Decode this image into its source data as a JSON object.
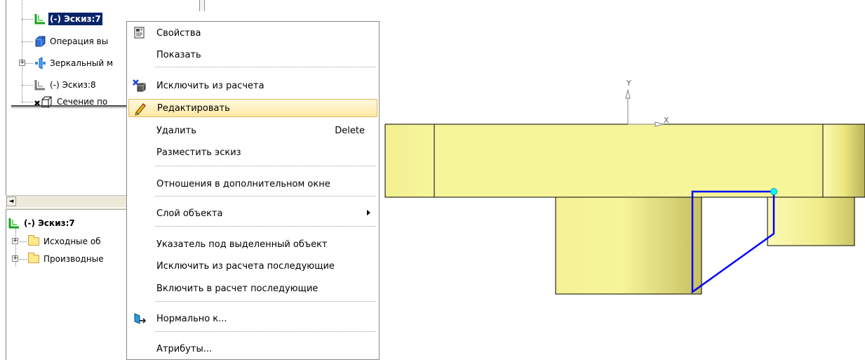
{
  "tree": {
    "nodes": [
      {
        "label": "(-) Эскиз:7",
        "icon": "sketch-icon",
        "selected": true
      },
      {
        "label": "Операция вы",
        "icon": "extrude-operation-icon"
      },
      {
        "label": "Зеркальный м",
        "icon": "mirror-array-icon",
        "expander": "+"
      },
      {
        "label": "(-) Эскиз:8",
        "icon": "sketch-gray-icon"
      },
      {
        "label": "Сечение по",
        "icon": "section-excluded-icon"
      }
    ],
    "lower": {
      "root": {
        "label": "(-) Эскиз:7",
        "icon": "sketch-icon"
      },
      "children": [
        {
          "label": "Исходные об",
          "icon": "folder-icon",
          "expander": "+"
        },
        {
          "label": "Производные",
          "icon": "folder-icon",
          "expander": "+"
        }
      ]
    },
    "scroll_arrow": "◄"
  },
  "menu": {
    "items": [
      {
        "id": "properties",
        "label": "Свойства",
        "icon": "properties-icon"
      },
      {
        "id": "show",
        "label": "Показать"
      },
      {
        "id": "exclude",
        "label": "Исключить из расчета",
        "icon": "exclude-icon"
      },
      {
        "id": "edit",
        "label": "Редактировать",
        "icon": "pencil-icon",
        "highlighted": true
      },
      {
        "id": "delete",
        "label": "Удалить",
        "shortcut": "Delete"
      },
      {
        "id": "place-sketch",
        "label": "Разместить эскиз"
      },
      {
        "id": "relations",
        "label": "Отношения в дополнительном окне"
      },
      {
        "id": "layer",
        "label": "Слой объекта",
        "submenu": true
      },
      {
        "id": "pointer",
        "label": "Указатель под выделенный объект"
      },
      {
        "id": "exclude-following",
        "label": "Исключить из расчета последующие"
      },
      {
        "id": "include-following",
        "label": "Включить в расчет последующие"
      },
      {
        "id": "normal-to",
        "label": "Нормально к...",
        "icon": "normal-to-icon"
      },
      {
        "id": "attributes",
        "label": "Атрибуты..."
      }
    ]
  },
  "viewport": {
    "axis_y_label": "Y",
    "axis_x_label": "X",
    "colors": {
      "body_fill": "#f7f59a",
      "body_shade": "#c4bf63",
      "sketch_line": "#0000ff",
      "point": "#00ffff",
      "outline": "#000000"
    }
  }
}
